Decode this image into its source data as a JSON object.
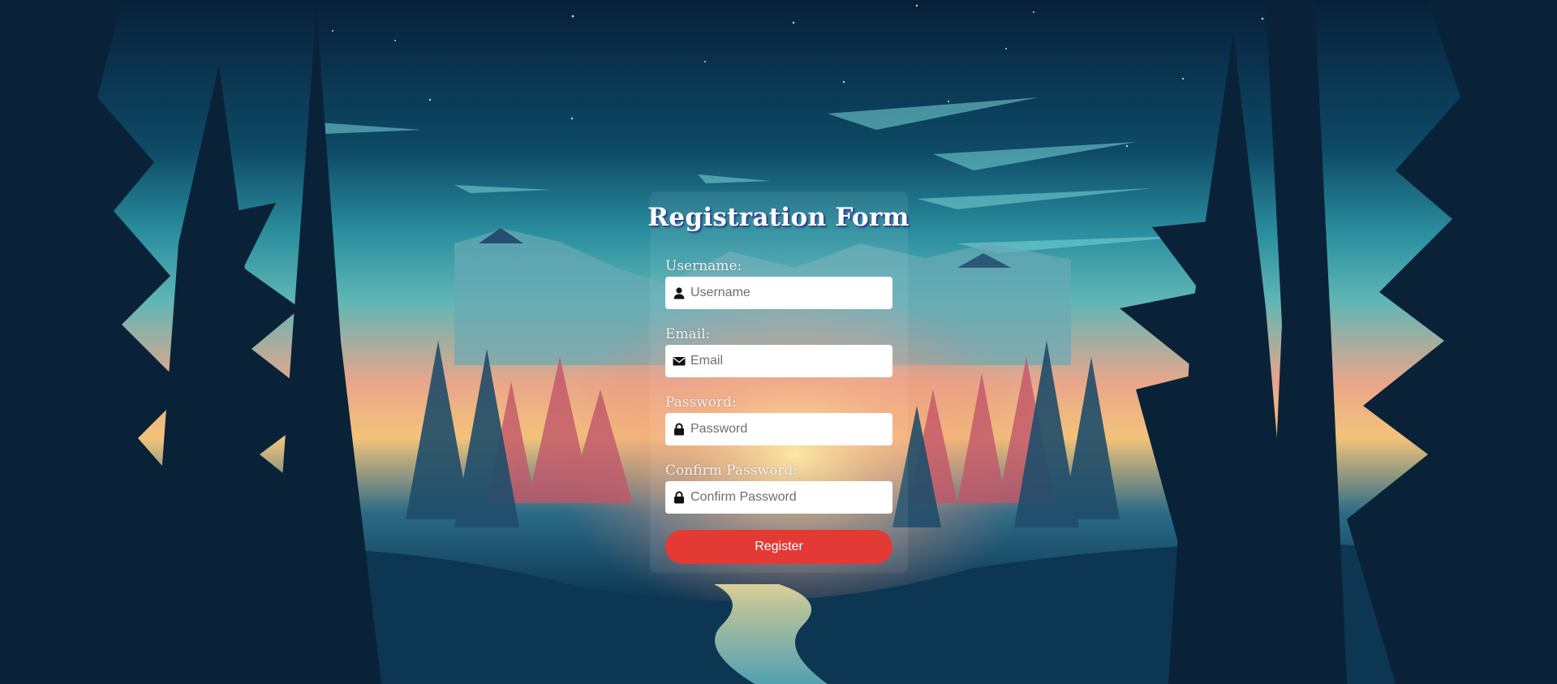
{
  "form": {
    "title": "Registration Form",
    "fields": [
      {
        "label": "Username:",
        "placeholder": "Username",
        "icon": "user-icon"
      },
      {
        "label": "Email:",
        "placeholder": "Email",
        "icon": "envelope-icon"
      },
      {
        "label": "Password:",
        "placeholder": "Password",
        "icon": "lock-icon"
      },
      {
        "label": "Confirm Password:",
        "placeholder": "Confirm Password",
        "icon": "lock-icon"
      }
    ],
    "submit_label": "Register"
  },
  "colors": {
    "button": "#e33a35",
    "field_background": "#ffffff",
    "label_text": "#f2f2f2"
  }
}
